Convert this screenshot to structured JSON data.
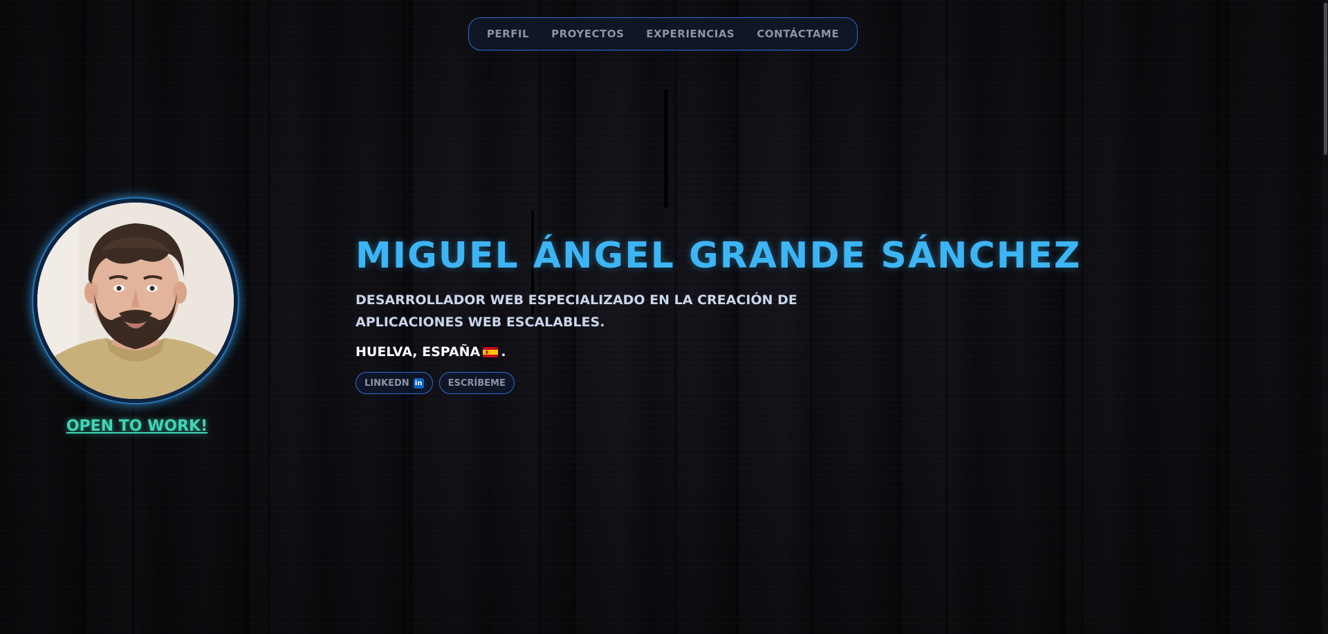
{
  "nav": {
    "items": [
      {
        "label": "PERFIL"
      },
      {
        "label": "PROYECTOS"
      },
      {
        "label": "EXPERIENCIAS"
      },
      {
        "label": "CONTÁCTAME"
      }
    ]
  },
  "profile": {
    "avatar_alt": "Foto de perfil",
    "status": "OPEN TO WORK!"
  },
  "hero": {
    "name": "MIGUEL ÁNGEL GRANDE SÁNCHEZ",
    "description": "DESARROLLADOR WEB ESPECIALIZADO EN LA CREACIÓN DE APLICACIONES WEB ESCALABLES.",
    "location": "HUELVA, ESPAÑA",
    "location_suffix": ".",
    "flag_icon": "spain-flag-icon",
    "buttons": {
      "linkedin_label": "LINKEDN",
      "linkedin_icon": "in",
      "write_label": "ESCRÍBEME"
    }
  },
  "colors": {
    "accent": "#3db5f5",
    "border": "#2f6bd6",
    "status": "#3fd6b6",
    "background": "#0b0b0e"
  }
}
